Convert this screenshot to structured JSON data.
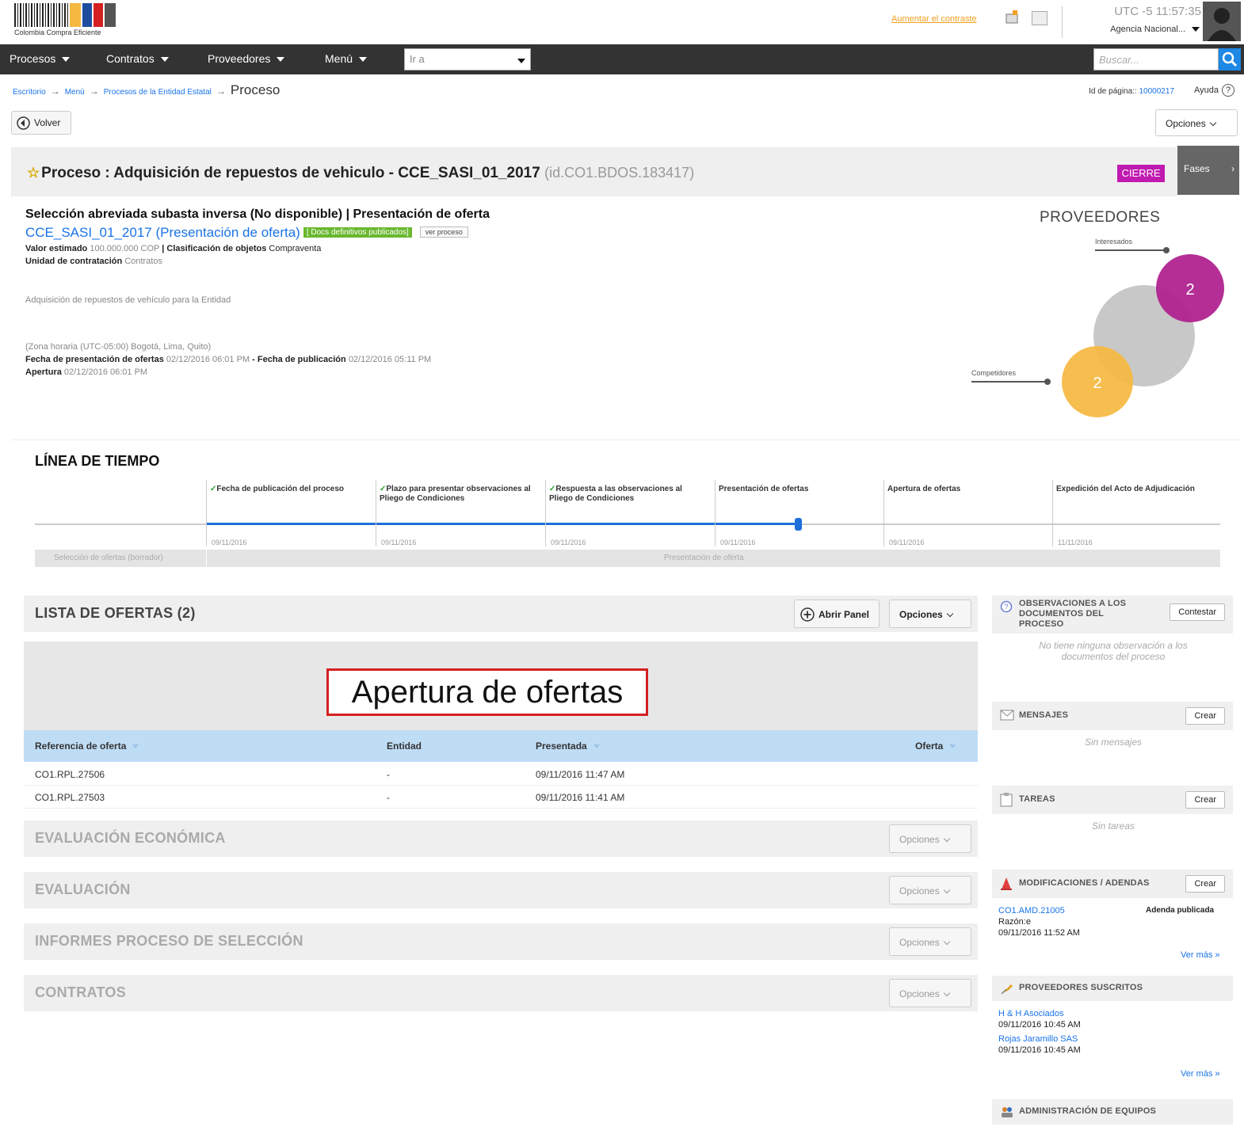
{
  "header": {
    "logo_text": "Colombia Compra Eficiente",
    "contrast_link": "Aumentar el contraste",
    "clock": "UTC -5 11:57:35",
    "agency": "Agencia Nacional..."
  },
  "nav": {
    "items": [
      "Procesos",
      "Contratos",
      "Proveedores",
      "Menú"
    ],
    "goto_placeholder": "Ir a",
    "search_placeholder": "Buscar..."
  },
  "breadcrumb": {
    "crumbs": [
      "Escritorio",
      "Menú",
      "Procesos de la Entidad Estatal"
    ],
    "current": "Proceso",
    "page_id_label": "Id de página::",
    "page_id_value": "10000217",
    "help": "Ayuda"
  },
  "toolbar": {
    "back": "Volver",
    "options": "Opciones"
  },
  "process": {
    "title": "Proceso : Adquisición de repuestos de vehiculo  - CCE_SASI_01_2017",
    "id": "(id.CO1.BDOS.183417)",
    "status": "CIERRE",
    "phases": "Fases",
    "subtitle": "Selección abreviada subasta inversa (No disponible) | Presentación de oferta",
    "reference": "CCE_SASI_01_2017 (Presentación de oferta)",
    "docs_badge": "[ Docs definitivos publicados]",
    "view_process": "ver proceso",
    "estimated_label": "Valor estimado",
    "estimated_value": "100.000.000 COP",
    "classification_label": "| Clasificación de objetos",
    "classification_value": "Compraventa",
    "unit_label": "Unidad de contratación",
    "unit_value": "Contratos",
    "description": "Adquisición de repuestos de vehículo para la Entidad",
    "timezone": "(Zona horaria (UTC-05:00) Bogotá, Lima, Quito)",
    "offer_date_label": "Fecha de presentación de ofertas",
    "offer_date_value": "02/12/2016 06:01 PM",
    "pub_date_label": "- Fecha de publicación",
    "pub_date_value": "02/12/2016 05:11 PM",
    "opening_label": "Apertura",
    "opening_value": "02/12/2016 06:01 PM"
  },
  "providers": {
    "title": "PROVEEDORES",
    "interested_label": "Interesados",
    "competitors_label": "Competidores",
    "interested_count": "2",
    "competitors_count": "2",
    "colors": {
      "interested": "#b0238f",
      "competitors": "#f5b840",
      "total": "#c8c8c8"
    }
  },
  "timeline": {
    "title": "LÍNEA DE TIEMPO",
    "milestones": [
      {
        "label": "Fecha de publicación del proceso",
        "date": "09/11/2016",
        "done": true
      },
      {
        "label": "Plazo para presentar observaciones al Pliego de Condiciones",
        "date": "09/11/2016",
        "done": true
      },
      {
        "label": "Respuesta a las observaciones al Pliego de Condiciones",
        "date": "09/11/2016",
        "done": true
      },
      {
        "label": "Presentación de ofertas",
        "date": "09/11/2016",
        "done": false
      },
      {
        "label": "Apertura de ofertas",
        "date": "09/11/2016",
        "done": false
      },
      {
        "label": "Expedición del Acto de Adjudicación",
        "date": "11/11/2016",
        "done": false
      }
    ],
    "stages": [
      "Selección de ofertas (borrador)",
      "Presentación de oferta"
    ]
  },
  "offers": {
    "title": "LISTA DE OFERTAS (2)",
    "open_panel": "Abrir Panel",
    "options": "Opciones",
    "highlight": "Apertura de ofertas",
    "columns": [
      "Referencia de oferta",
      "Entidad",
      "Presentada",
      "Oferta"
    ],
    "rows": [
      {
        "ref": "CO1.RPL.27506",
        "entity": "-",
        "date": "09/11/2016 11:47 AM"
      },
      {
        "ref": "CO1.RPL.27503",
        "entity": "-",
        "date": "09/11/2016 11:41 AM"
      }
    ]
  },
  "sections": [
    {
      "title": "EVALUACIÓN ECONÓMICA",
      "options": "Opciones"
    },
    {
      "title": "EVALUACIÓN",
      "options": "Opciones"
    },
    {
      "title": "INFORMES PROCESO DE SELECCIÓN",
      "options": "Opciones"
    },
    {
      "title": "CONTRATOS",
      "options": "Opciones"
    }
  ],
  "sidebar": {
    "observations": {
      "title": "OBSERVACIONES A LOS DOCUMENTOS DEL PROCESO",
      "button": "Contestar",
      "empty": "No tiene ninguna observación a los documentos del proceso"
    },
    "messages": {
      "title": "MENSAJES",
      "button": "Crear",
      "empty": "Sin mensajes"
    },
    "tasks": {
      "title": "TAREAS",
      "button": "Crear",
      "empty": "Sin tareas"
    },
    "amendments": {
      "title": "MODIFICACIONES / ADENDAS",
      "button": "Crear",
      "ref": "CO1.AMD.21005",
      "status": "Adenda publicada",
      "reason": "Razón:e",
      "date": "09/11/2016 11:52 AM",
      "more": "Ver más »"
    },
    "subscribed": {
      "title": "PROVEEDORES SUSCRITOS",
      "items": [
        {
          "name": "H & H Asociados",
          "date": "09/11/2016 10:45 AM"
        },
        {
          "name": "Rojas Jaramillo SAS",
          "date": "09/11/2016 10:45 AM"
        }
      ],
      "more": "Ver más »"
    },
    "teams": {
      "title": "ADMINISTRACIÓN DE EQUIPOS"
    }
  }
}
